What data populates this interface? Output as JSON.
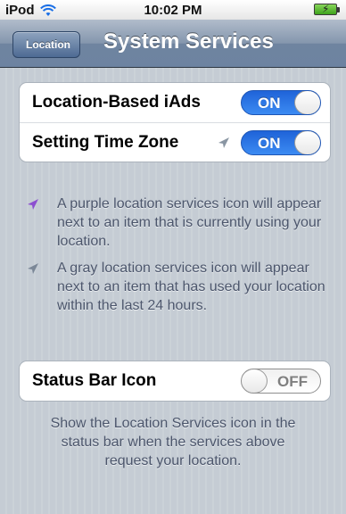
{
  "status_bar": {
    "carrier": "iPod",
    "time": "10:02 PM",
    "wifi_icon": "wifi-icon",
    "battery_icon": "battery-charging-icon"
  },
  "nav": {
    "back_label": "Location",
    "title": "System Services"
  },
  "group1": {
    "items": [
      {
        "label": "Location-Based iAds",
        "toggle": "ON"
      },
      {
        "label": "Setting Time Zone",
        "toggle": "ON",
        "icon": "gray-location-arrow-icon"
      }
    ]
  },
  "notes": {
    "purple": "A purple location services icon will appear next to an item that is currently using your location.",
    "gray": "A gray location services icon will appear next to an item that has used your location within the last 24 hours."
  },
  "group2": {
    "label": "Status Bar Icon",
    "toggle": "OFF"
  },
  "footer": {
    "text": "Show the Location Services icon in the status bar when the services above request your location."
  },
  "colors": {
    "nav_blue": "#6d83a1",
    "toggle_on": "#2f78e6",
    "purple_icon": "#8c4fd0",
    "gray_icon": "#7b8797"
  }
}
